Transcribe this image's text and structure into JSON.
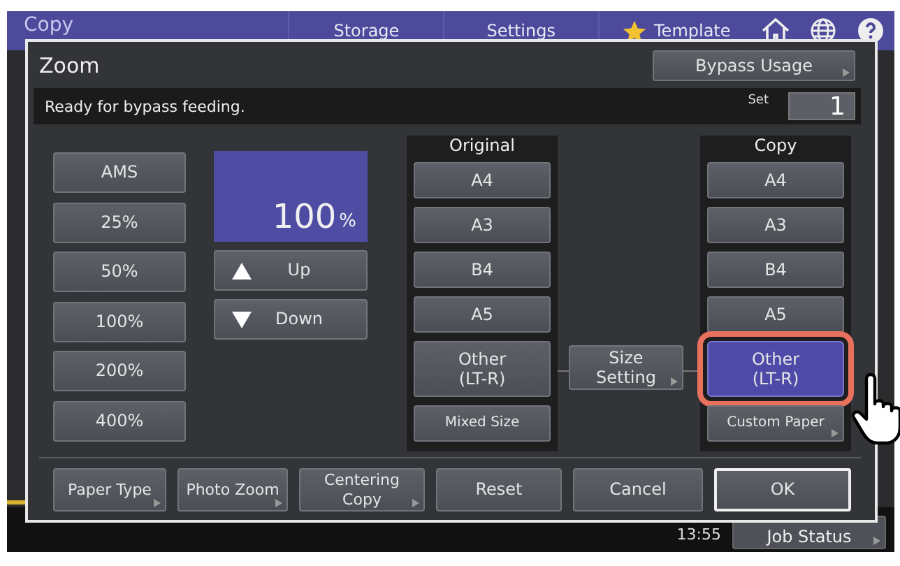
{
  "top_bar": {
    "title": "Copy",
    "tabs": [
      {
        "label": "Storage",
        "kind": "plain"
      },
      {
        "label": "Settings",
        "kind": "plain"
      },
      {
        "label": "Template",
        "kind": "star"
      }
    ]
  },
  "status_area": {
    "time": "13:55",
    "job_status": "Job Status"
  },
  "dialog": {
    "title": "Zoom",
    "bypass_button": "Bypass Usage",
    "message": "Ready for bypass feeding.",
    "set_label": "Set",
    "set_value": "1",
    "presets": [
      "AMS",
      "25%",
      "50%",
      "100%",
      "200%",
      "400%"
    ],
    "zoom_value": "100",
    "zoom_unit": "%",
    "up": "Up",
    "down": "Down",
    "original": {
      "heading": "Original",
      "sizes": [
        {
          "label": "A4",
          "kind": "single",
          "selected": false
        },
        {
          "label": "A3",
          "kind": "single",
          "selected": false
        },
        {
          "label": "B4",
          "kind": "single",
          "selected": false
        },
        {
          "label": "A5",
          "kind": "single",
          "selected": false
        },
        {
          "label": "Other\n(LT-R)",
          "kind": "double",
          "selected": false
        },
        {
          "label": "Mixed Size",
          "kind": "small",
          "selected": false
        }
      ]
    },
    "size_setting": "Size\nSetting",
    "copy": {
      "heading": "Copy",
      "sizes": [
        {
          "label": "A4",
          "kind": "single",
          "selected": false,
          "highlighted": false
        },
        {
          "label": "A3",
          "kind": "single",
          "selected": false,
          "highlighted": false
        },
        {
          "label": "B4",
          "kind": "single",
          "selected": false,
          "highlighted": false
        },
        {
          "label": "A5",
          "kind": "single",
          "selected": false,
          "highlighted": false
        },
        {
          "label": "Other\n(LT-R)",
          "kind": "double",
          "selected": true,
          "highlighted": true
        },
        {
          "label": "Custom Paper",
          "kind": "small",
          "selected": false,
          "highlighted": false
        }
      ]
    },
    "bottom_buttons": [
      {
        "label": "Paper Type",
        "kind": "sub"
      },
      {
        "label": "Photo Zoom",
        "kind": "sub"
      },
      {
        "label": "Centering\nCopy",
        "kind": "sub"
      },
      {
        "label": "Reset",
        "kind": "plain"
      },
      {
        "label": "Cancel",
        "kind": "plain"
      },
      {
        "label": "OK",
        "kind": "default"
      }
    ]
  }
}
